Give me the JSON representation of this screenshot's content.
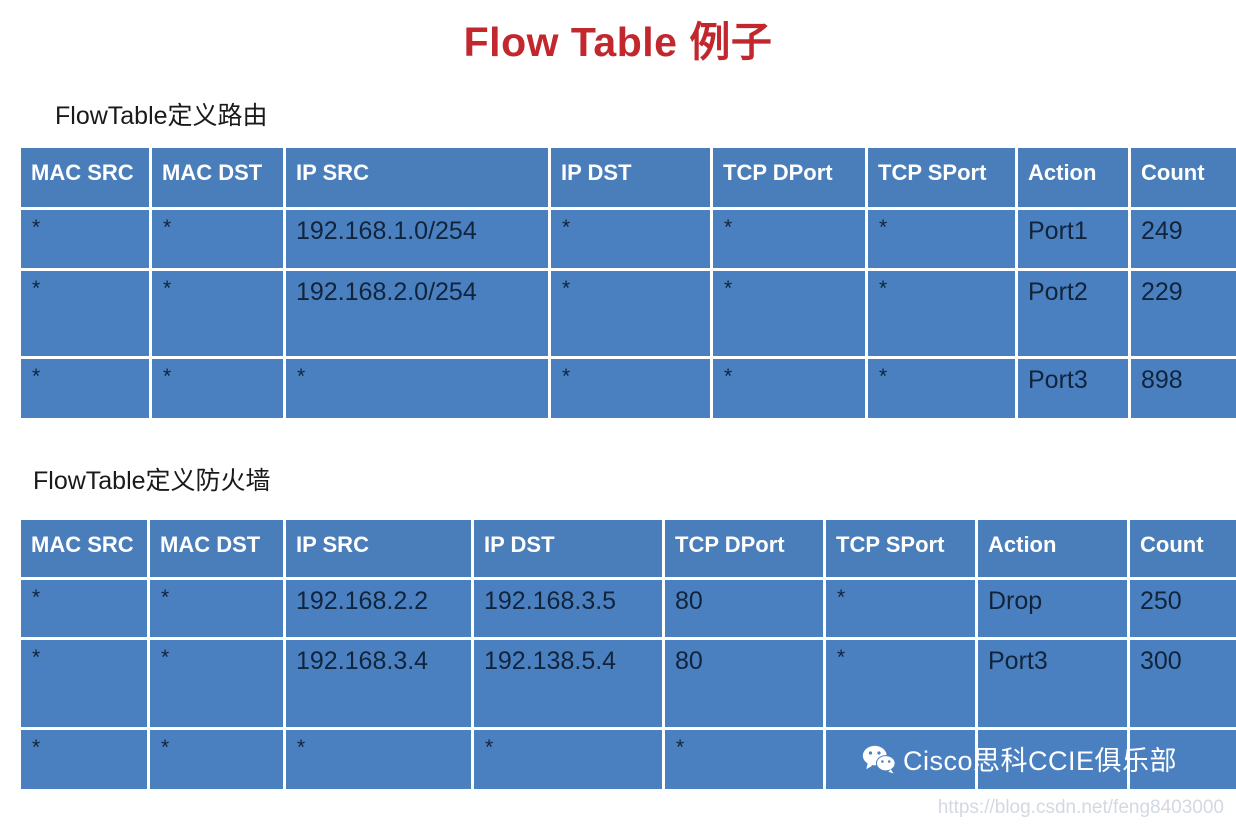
{
  "page": {
    "title": "Flow Table 例子",
    "title_color": "#c1272d",
    "background": "#ffffff"
  },
  "theme": {
    "header_blue": "#4a7ebb",
    "cell_blue": "#4a80c0",
    "grid_white": "#ffffff",
    "cell_text": "#12243c",
    "header_text": "#ffffff"
  },
  "sections": {
    "routing": {
      "caption": "FlowTable定义路由",
      "table": {
        "columns": [
          "MAC SRC",
          "MAC DST",
          "IP SRC",
          "IP DST",
          "TCP DPort",
          "TCP SPort",
          "Action",
          "Count"
        ],
        "rows": [
          [
            "*",
            "*",
            "192.168.1.0/254",
            "*",
            "*",
            "*",
            "Port1",
            "249"
          ],
          [
            "*",
            "*",
            "192.168.2.0/254",
            "*",
            "*",
            "*",
            "Port2",
            "229"
          ],
          [
            "*",
            "*",
            "*",
            "*",
            "*",
            "*",
            "Port3",
            "898"
          ]
        ]
      }
    },
    "firewall": {
      "caption": "FlowTable定义防火墙",
      "table": {
        "columns": [
          "MAC SRC",
          "MAC DST",
          "IP SRC",
          "IP DST",
          "TCP DPort",
          "TCP SPort",
          "Action",
          "Count"
        ],
        "rows": [
          [
            "*",
            "*",
            "192.168.2.2",
            "192.168.3.5",
            "80",
            "*",
            "Drop",
            "250"
          ],
          [
            "*",
            "*",
            "192.168.3.4",
            "192.138.5.4",
            "80",
            "*",
            "Port3",
            "300"
          ],
          [
            "*",
            "*",
            "*",
            "*",
            "*",
            "",
            "",
            ""
          ]
        ]
      }
    }
  },
  "watermarks": {
    "wechat": {
      "icon": "wechat-icon",
      "label": "Cisco思科CCIE俱乐部"
    },
    "csdn_url": "https://blog.csdn.net/feng8403000"
  }
}
